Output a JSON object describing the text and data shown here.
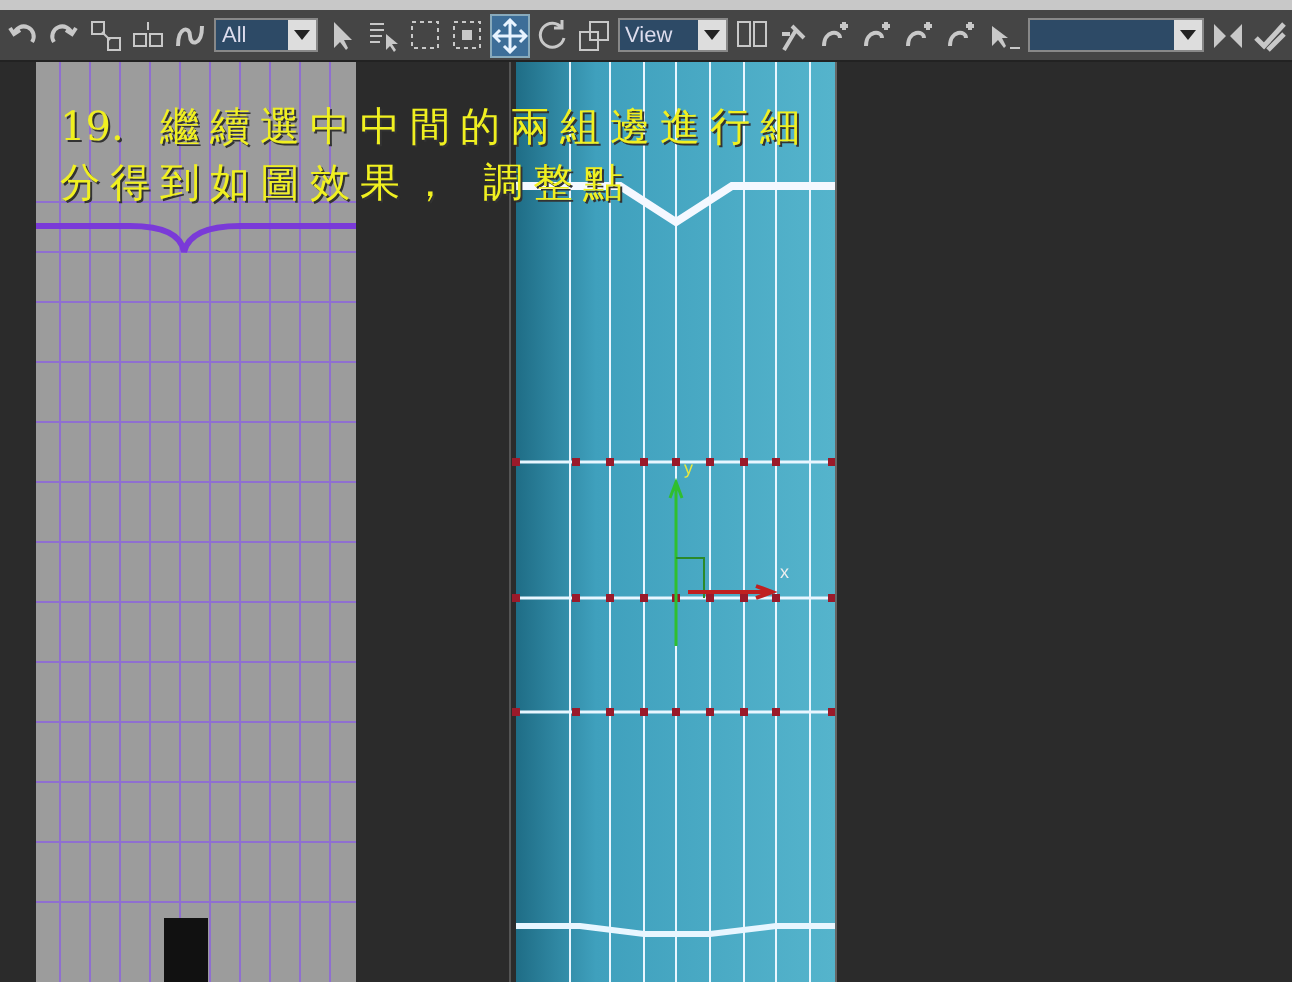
{
  "toolbar": {
    "tools": [
      {
        "kind": "undo",
        "selected": false
      },
      {
        "kind": "redo",
        "selected": false
      },
      {
        "kind": "link",
        "selected": false
      },
      {
        "kind": "unlink",
        "selected": false
      },
      {
        "kind": "bind",
        "selected": false
      },
      {
        "kind": "filter",
        "value": "All"
      },
      {
        "kind": "select",
        "selected": false
      },
      {
        "kind": "select-by-name",
        "selected": false
      },
      {
        "kind": "region",
        "selected": false
      },
      {
        "kind": "crossing",
        "selected": false
      },
      {
        "kind": "move",
        "selected": true
      },
      {
        "kind": "rotate",
        "selected": false
      },
      {
        "kind": "scale",
        "selected": false
      },
      {
        "kind": "coordinates",
        "value": "View"
      },
      {
        "kind": "pivot",
        "selected": false
      },
      {
        "kind": "manipulate",
        "selected": false
      },
      {
        "kind": "snap",
        "selected": false
      },
      {
        "kind": "snap",
        "selected": false
      },
      {
        "kind": "snap",
        "selected": false
      },
      {
        "kind": "snap",
        "selected": false
      },
      {
        "kind": "named-selection",
        "selected": false
      },
      {
        "kind": "named-dropdown"
      },
      {
        "kind": "mirror",
        "selected": false
      },
      {
        "kind": "align",
        "selected": false
      }
    ]
  },
  "caption": {
    "number": "19.",
    "lines": [
      "繼續選中中間的兩組邊進行細",
      "分得到如圖效果， 調整點"
    ]
  },
  "gizmo": {
    "y_label": "y",
    "x_label": "x"
  }
}
